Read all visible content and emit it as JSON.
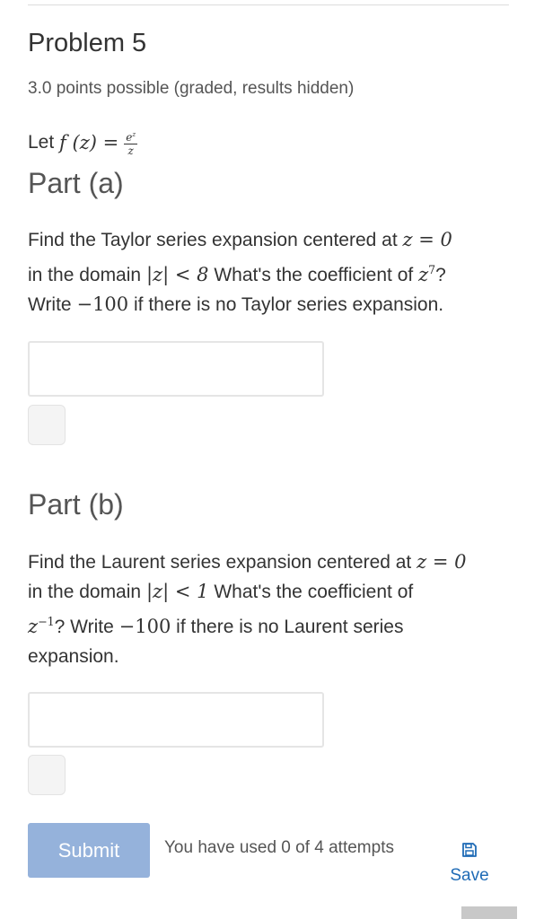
{
  "problem": {
    "title": "Problem 5",
    "subtitle": "3.0 points possible (graded, results hidden)",
    "let_text": "Let",
    "function_def": "f (z) =",
    "fraction_numerator": "e",
    "fraction_numerator_exp": "z",
    "fraction_denominator": "z"
  },
  "part_a": {
    "heading": "Part (a)",
    "line1_text": "Find the Taylor series expansion centered at",
    "line1_math": "z = 0",
    "line2_text_pre": "in the domain",
    "line2_math": "|z| < 8",
    "line2_text_post": "What's the coefficient of",
    "line2_math_var": "z",
    "line2_math_exp": "7",
    "line2_qmark": "?",
    "line3_text_pre": "Write",
    "line3_math": "−100",
    "line3_text_post": "if there is no Taylor series expansion.",
    "input_value": ""
  },
  "part_b": {
    "heading": "Part (b)",
    "line1_text": "Find the Laurent series expansion centered at",
    "line1_math": "z = 0",
    "line2_text_pre": "in the domain",
    "line2_math": "|z| < 1",
    "line2_text_post": "What's the coefficient of",
    "line3_math_var": "z",
    "line3_math_exp": "−1",
    "line3_text_pre": "? Write",
    "line3_math": "−100",
    "line3_text_post": "if there is no Laurent series",
    "line4_text": "expansion.",
    "input_value": ""
  },
  "actions": {
    "submit_label": "Submit",
    "attempts_text": "You have used 0 of 4 attempts",
    "save_label": "Save",
    "save_icon": "floppy-disk-icon"
  },
  "colors": {
    "submit_bg": "#95b2db",
    "link": "#1f6bb6"
  }
}
